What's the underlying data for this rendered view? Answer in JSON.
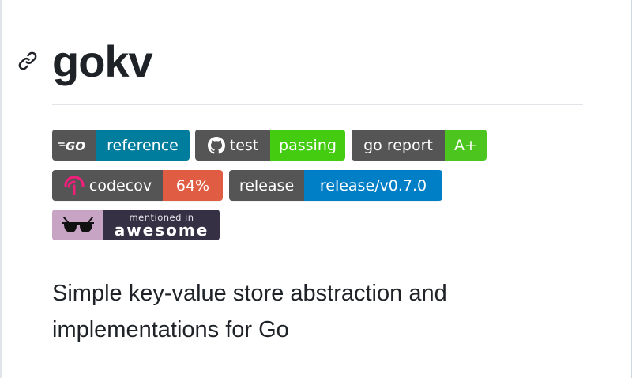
{
  "header": {
    "title": "gokv"
  },
  "badges": {
    "go_reference": {
      "left": "GO",
      "right": "reference",
      "right_color": "#007d9c"
    },
    "test": {
      "left": "test",
      "right": "passing",
      "right_color": "#44cc11"
    },
    "go_report": {
      "left": "go report",
      "right": "A+",
      "right_color": "#4cc61e"
    },
    "codecov": {
      "left": "codecov",
      "right": "64%",
      "right_color": "#e05d44"
    },
    "release": {
      "left": "release",
      "right": "release/v0.7.0",
      "right_color": "#007ec6"
    },
    "awesome": {
      "top": "mentioned in",
      "bottom": "awesome"
    }
  },
  "description": {
    "line1": "Simple key-value store abstraction and",
    "line2": "implementations for Go"
  },
  "icons": [
    "link-icon",
    "go-logo-icon",
    "github-icon",
    "codecov-icon",
    "sunglasses-icon"
  ],
  "colors": {
    "badge_left_bg": "#555555",
    "text": "#1f2328",
    "rule": "#e1e4e8"
  }
}
